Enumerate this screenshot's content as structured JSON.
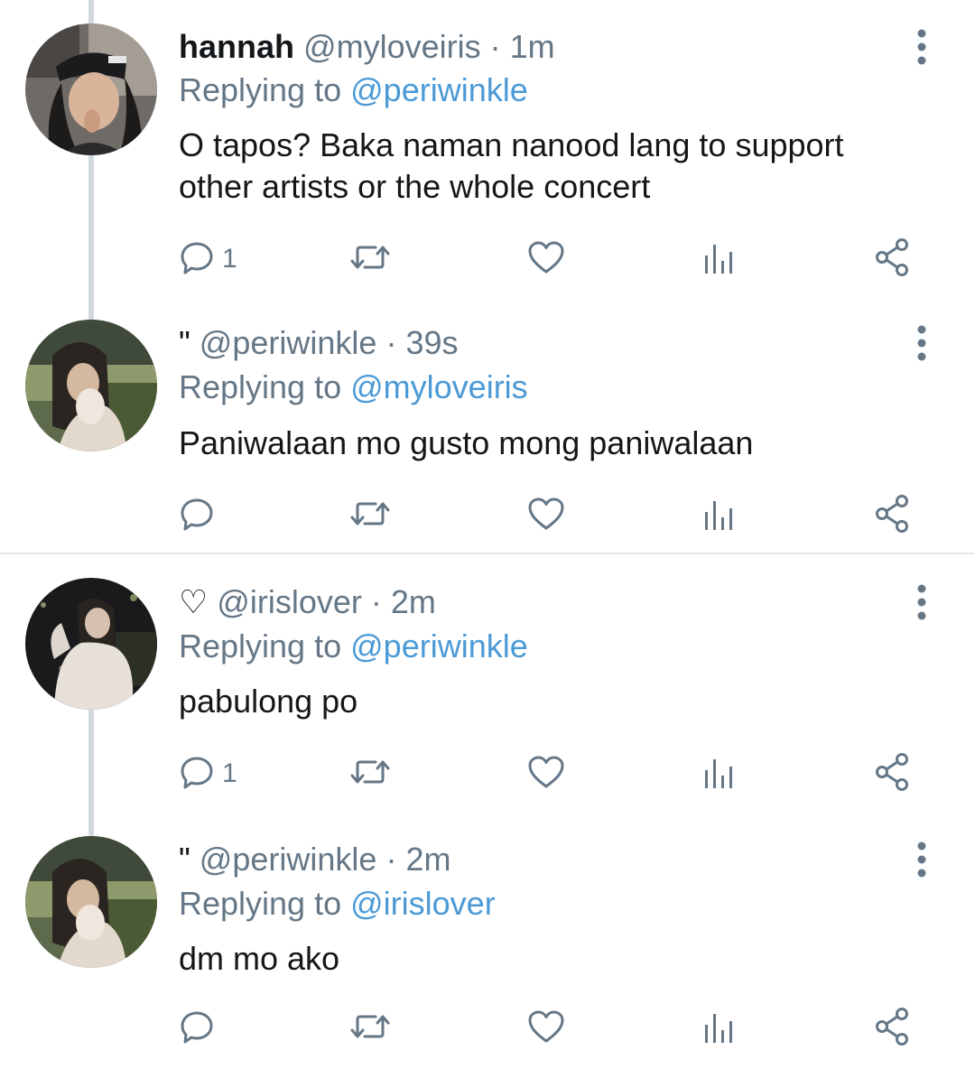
{
  "tweets": [
    {
      "display_name": "hannah",
      "symbol": "",
      "handle": "@myloveiris",
      "separator": "·",
      "time": "1m",
      "replying_prefix": "Replying to",
      "replying_to": "@periwinkle",
      "text": "O tapos? Baka naman nanood lang to support other artists or the whole concert",
      "reply_count": "1"
    },
    {
      "display_name": "",
      "symbol": "\"",
      "handle": "@periwinkle",
      "separator": "·",
      "time": "39s",
      "replying_prefix": "Replying to",
      "replying_to": "@myloveiris",
      "text": "Paniwalaan mo gusto mong paniwalaan",
      "reply_count": ""
    },
    {
      "display_name": "",
      "symbol": "♡",
      "handle": "@irislover",
      "separator": "·",
      "time": "2m",
      "replying_prefix": "Replying to",
      "replying_to": "@periwinkle",
      "text": "pabulong po",
      "reply_count": "1"
    },
    {
      "display_name": "",
      "symbol": "\"",
      "handle": "@periwinkle",
      "separator": "·",
      "time": "2m",
      "replying_prefix": "Replying to",
      "replying_to": "@irislover",
      "text": "dm mo ako",
      "reply_count": ""
    }
  ],
  "icons": {
    "reply": "reply-icon",
    "retweet": "retweet-icon",
    "like": "heart-icon",
    "analytics": "analytics-icon",
    "share": "share-icon",
    "more": "more-vertical-icon"
  },
  "colors": {
    "mention": "#4b9ad6",
    "muted": "#657786",
    "text": "#14171a",
    "thread_line": "#cfd9de",
    "divider": "#e1e8ed"
  }
}
